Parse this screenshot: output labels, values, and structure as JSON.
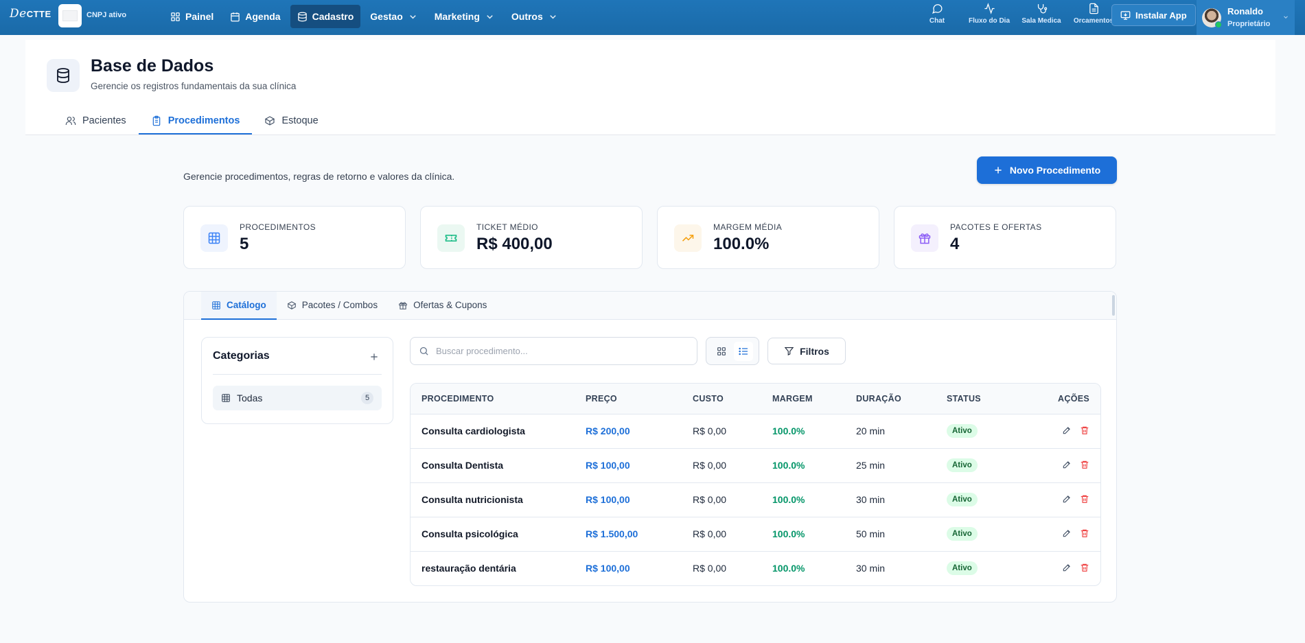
{
  "topbar": {
    "logo_main": "De",
    "logo_suffix": "CTTE",
    "cnpj_status": "CNPJ ativo",
    "nav": [
      {
        "label": "Painel",
        "icon": "grid-icon"
      },
      {
        "label": "Agenda",
        "icon": "calendar-icon"
      },
      {
        "label": "Cadastro",
        "icon": "database-icon",
        "active": true
      },
      {
        "label": "Gestao",
        "icon": "chevron-down-icon"
      },
      {
        "label": "Marketing",
        "icon": "chevron-down-icon"
      },
      {
        "label": "Outros",
        "icon": "chevron-down-icon"
      }
    ],
    "tools": [
      {
        "label": "Chat",
        "icon": "chat-icon"
      },
      {
        "label": "Fluxo do Dia",
        "icon": "activity-icon"
      },
      {
        "label": "Sala Medica",
        "icon": "stethoscope-icon"
      },
      {
        "label": "Orcamentos",
        "icon": "document-icon"
      }
    ],
    "install_label": "Instalar App",
    "user": {
      "name": "Ronaldo",
      "role": "Proprietário"
    }
  },
  "header": {
    "title": "Base de Dados",
    "subtitle": "Gerencie os registros fundamentais da sua clínica",
    "tabs": [
      {
        "label": "Pacientes",
        "icon": "users-icon"
      },
      {
        "label": "Procedimentos",
        "icon": "clipboard-icon",
        "active": true
      },
      {
        "label": "Estoque",
        "icon": "box-icon"
      }
    ]
  },
  "content": {
    "intro": "Gerencie procedimentos, regras de retorno e valores da clínica.",
    "new_button": "Novo Procedimento",
    "stats": [
      {
        "label": "PROCEDIMENTOS",
        "value": "5",
        "icon": "table-icon",
        "color": "#3b82f6"
      },
      {
        "label": "TICKET MÉDIO",
        "value": "R$ 400,00",
        "icon": "ticket-icon",
        "color": "#10b981"
      },
      {
        "label": "MARGEM MÉDIA",
        "value": "100.0%",
        "icon": "trending-up-icon",
        "color": "#f59e0b"
      },
      {
        "label": "PACOTES E OFERTAS",
        "value": "4",
        "icon": "gift-icon",
        "color": "#8b5cf6"
      }
    ],
    "catalog_tabs": [
      {
        "label": "Catálogo",
        "icon": "table-icon",
        "active": true
      },
      {
        "label": "Pacotes / Combos",
        "icon": "box-icon"
      },
      {
        "label": "Ofertas & Cupons",
        "icon": "gift-icon"
      }
    ],
    "categories": {
      "title": "Categorias",
      "items": [
        {
          "label": "Todas",
          "count": "5"
        }
      ]
    },
    "search_placeholder": "Buscar procedimento...",
    "filters_label": "Filtros",
    "table": {
      "headers": [
        "PROCEDIMENTO",
        "PREÇO",
        "CUSTO",
        "MARGEM",
        "DURAÇÃO",
        "STATUS",
        "AÇÕES"
      ],
      "rows": [
        {
          "name": "Consulta cardiologista",
          "price": "R$ 200,00",
          "cost": "R$ 0,00",
          "margin": "100.0%",
          "duration": "20 min",
          "status": "Ativo"
        },
        {
          "name": "Consulta Dentista",
          "price": "R$ 100,00",
          "cost": "R$ 0,00",
          "margin": "100.0%",
          "duration": "25 min",
          "status": "Ativo"
        },
        {
          "name": "Consulta nutricionista",
          "price": "R$ 100,00",
          "cost": "R$ 0,00",
          "margin": "100.0%",
          "duration": "30 min",
          "status": "Ativo"
        },
        {
          "name": "Consulta psicológica",
          "price": "R$ 1.500,00",
          "cost": "R$ 0,00",
          "margin": "100.0%",
          "duration": "50 min",
          "status": "Ativo"
        },
        {
          "name": "restauração dentária",
          "price": "R$ 100,00",
          "cost": "R$ 0,00",
          "margin": "100.0%",
          "duration": "30 min",
          "status": "Ativo"
        }
      ]
    }
  },
  "colors": {
    "primary": "#1d6fd8",
    "topbar": "#1f75b8",
    "success": "#059669",
    "danger": "#ef4444"
  }
}
